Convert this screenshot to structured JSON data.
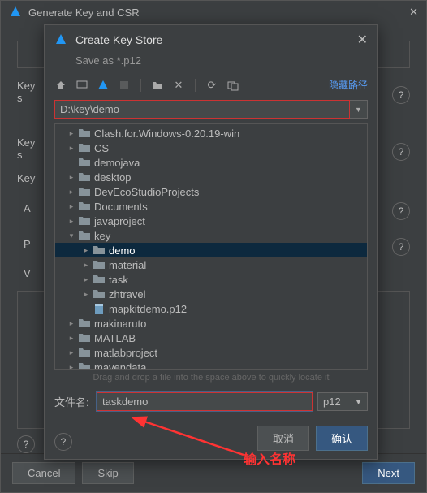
{
  "outer": {
    "title": "Generate Key and CSR",
    "labels": {
      "keys": "Key s",
      "keys2": "Key s",
      "key": "Key",
      "a": "A",
      "p": "P",
      "v": "V"
    },
    "footer": {
      "cancel": "Cancel",
      "skip": "Skip",
      "next": "Next"
    }
  },
  "modal": {
    "title": "Create Key Store",
    "subtitle": "Save as *.p12",
    "path_value": "D:\\key\\demo",
    "hide_path_label": "隐藏路径",
    "drag_hint": "Drag and drop a file into the space above to quickly locate it",
    "filename_label": "文件名:",
    "filename_value": "taskdemo",
    "ext_value": "p12",
    "footer": {
      "cancel": "取消",
      "confirm": "确认"
    }
  },
  "tree": [
    {
      "depth": 0,
      "arrow": "right",
      "icon": "folder",
      "label": "Clash.for.Windows-0.20.19-win"
    },
    {
      "depth": 0,
      "arrow": "right",
      "icon": "folder",
      "label": "CS"
    },
    {
      "depth": 0,
      "arrow": "none",
      "icon": "folder",
      "label": "demojava"
    },
    {
      "depth": 0,
      "arrow": "right",
      "icon": "folder",
      "label": "desktop"
    },
    {
      "depth": 0,
      "arrow": "right",
      "icon": "folder",
      "label": "DevEcoStudioProjects"
    },
    {
      "depth": 0,
      "arrow": "right",
      "icon": "folder",
      "label": "Documents"
    },
    {
      "depth": 0,
      "arrow": "right",
      "icon": "folder",
      "label": "javaproject"
    },
    {
      "depth": 0,
      "arrow": "down",
      "icon": "folder",
      "label": "key"
    },
    {
      "depth": 1,
      "arrow": "right",
      "icon": "folder",
      "label": "demo",
      "selected": true
    },
    {
      "depth": 1,
      "arrow": "right",
      "icon": "folder",
      "label": "material"
    },
    {
      "depth": 1,
      "arrow": "right",
      "icon": "folder",
      "label": "task"
    },
    {
      "depth": 1,
      "arrow": "right",
      "icon": "folder",
      "label": "zhtravel"
    },
    {
      "depth": 1,
      "arrow": "none",
      "icon": "file",
      "label": "mapkitdemo.p12"
    },
    {
      "depth": 0,
      "arrow": "right",
      "icon": "folder",
      "label": "makinaruto"
    },
    {
      "depth": 0,
      "arrow": "right",
      "icon": "folder",
      "label": "MATLAB"
    },
    {
      "depth": 0,
      "arrow": "right",
      "icon": "folder",
      "label": "matlabproject"
    },
    {
      "depth": 0,
      "arrow": "right",
      "icon": "folder",
      "label": "mavendata"
    }
  ],
  "annotation": {
    "text": "输入名称"
  }
}
